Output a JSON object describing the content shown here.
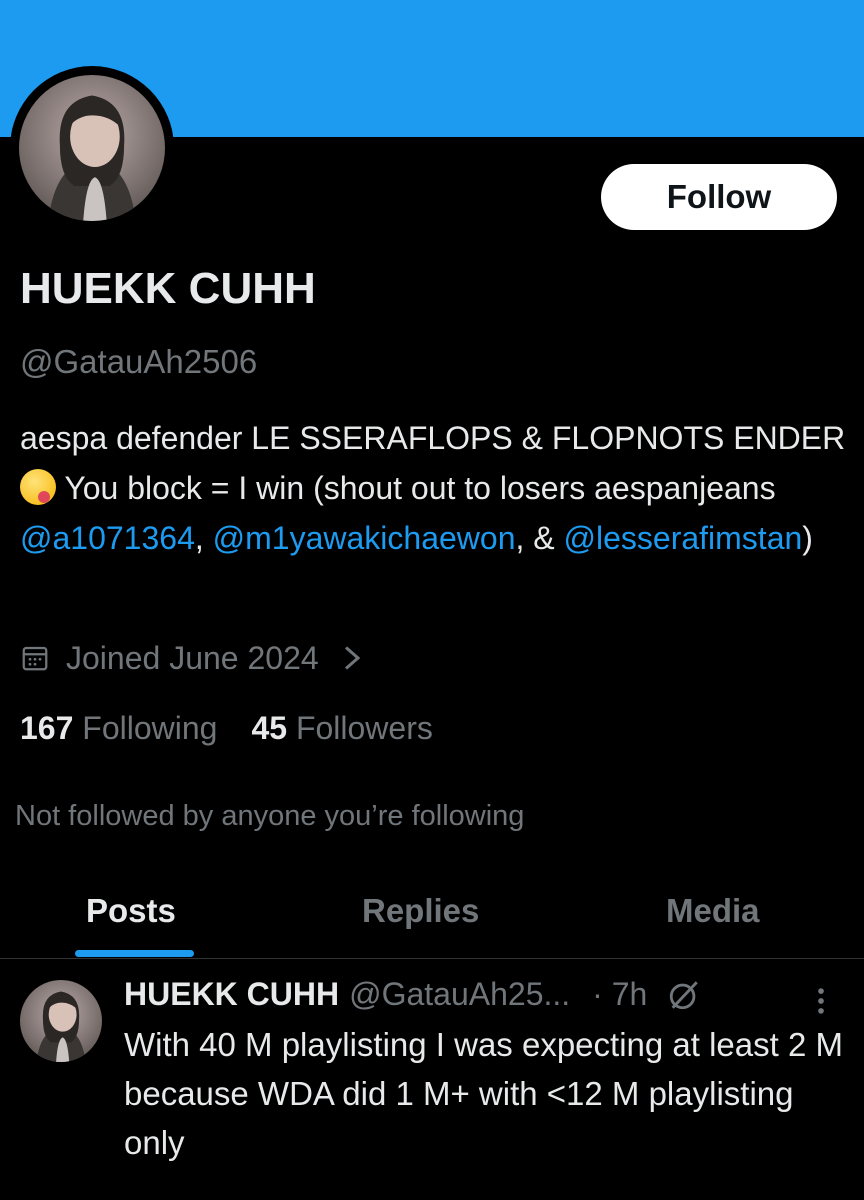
{
  "profile": {
    "display_name": "HUEKK CUHH",
    "handle": "@GatauAh2506",
    "follow_label": "Follow",
    "bio": {
      "part1": "aespa defender  LE SSERAFLOPS & FLOPNOTS ENDER",
      "part2": " You block = I win (shout out to losers aespanjeans ",
      "mention1": "@a1071364",
      "sep1": ", ",
      "mention2": "@m1yawakichaewon",
      "sep2": ", & ",
      "mention3": "@lesserafimstan",
      "end": ")"
    },
    "joined": "Joined June 2024",
    "following_count": "167",
    "following_label": "Following",
    "followers_count": "45",
    "followers_label": "Followers",
    "not_followed_text": "Not followed by anyone you’re following"
  },
  "tabs": [
    {
      "label": "Posts",
      "active": true
    },
    {
      "label": "Replies",
      "active": false
    },
    {
      "label": "Media",
      "active": false
    }
  ],
  "post": {
    "author": "HUEKK CUHH",
    "handle": "@GatauAh25...",
    "time": "· 7h",
    "text": "With 40 M playlisting I was expecting at least 2 M because WDA did 1 M+ with <12 M playlisting only"
  },
  "colors": {
    "banner": "#1d9bf0",
    "accent": "#1d9bf0",
    "background": "#000000",
    "muted_text": "#71767b"
  },
  "icons": [
    "calendar-icon",
    "chevron-right-icon",
    "grok-icon",
    "more-icon",
    "emoji-yum-icon"
  ]
}
